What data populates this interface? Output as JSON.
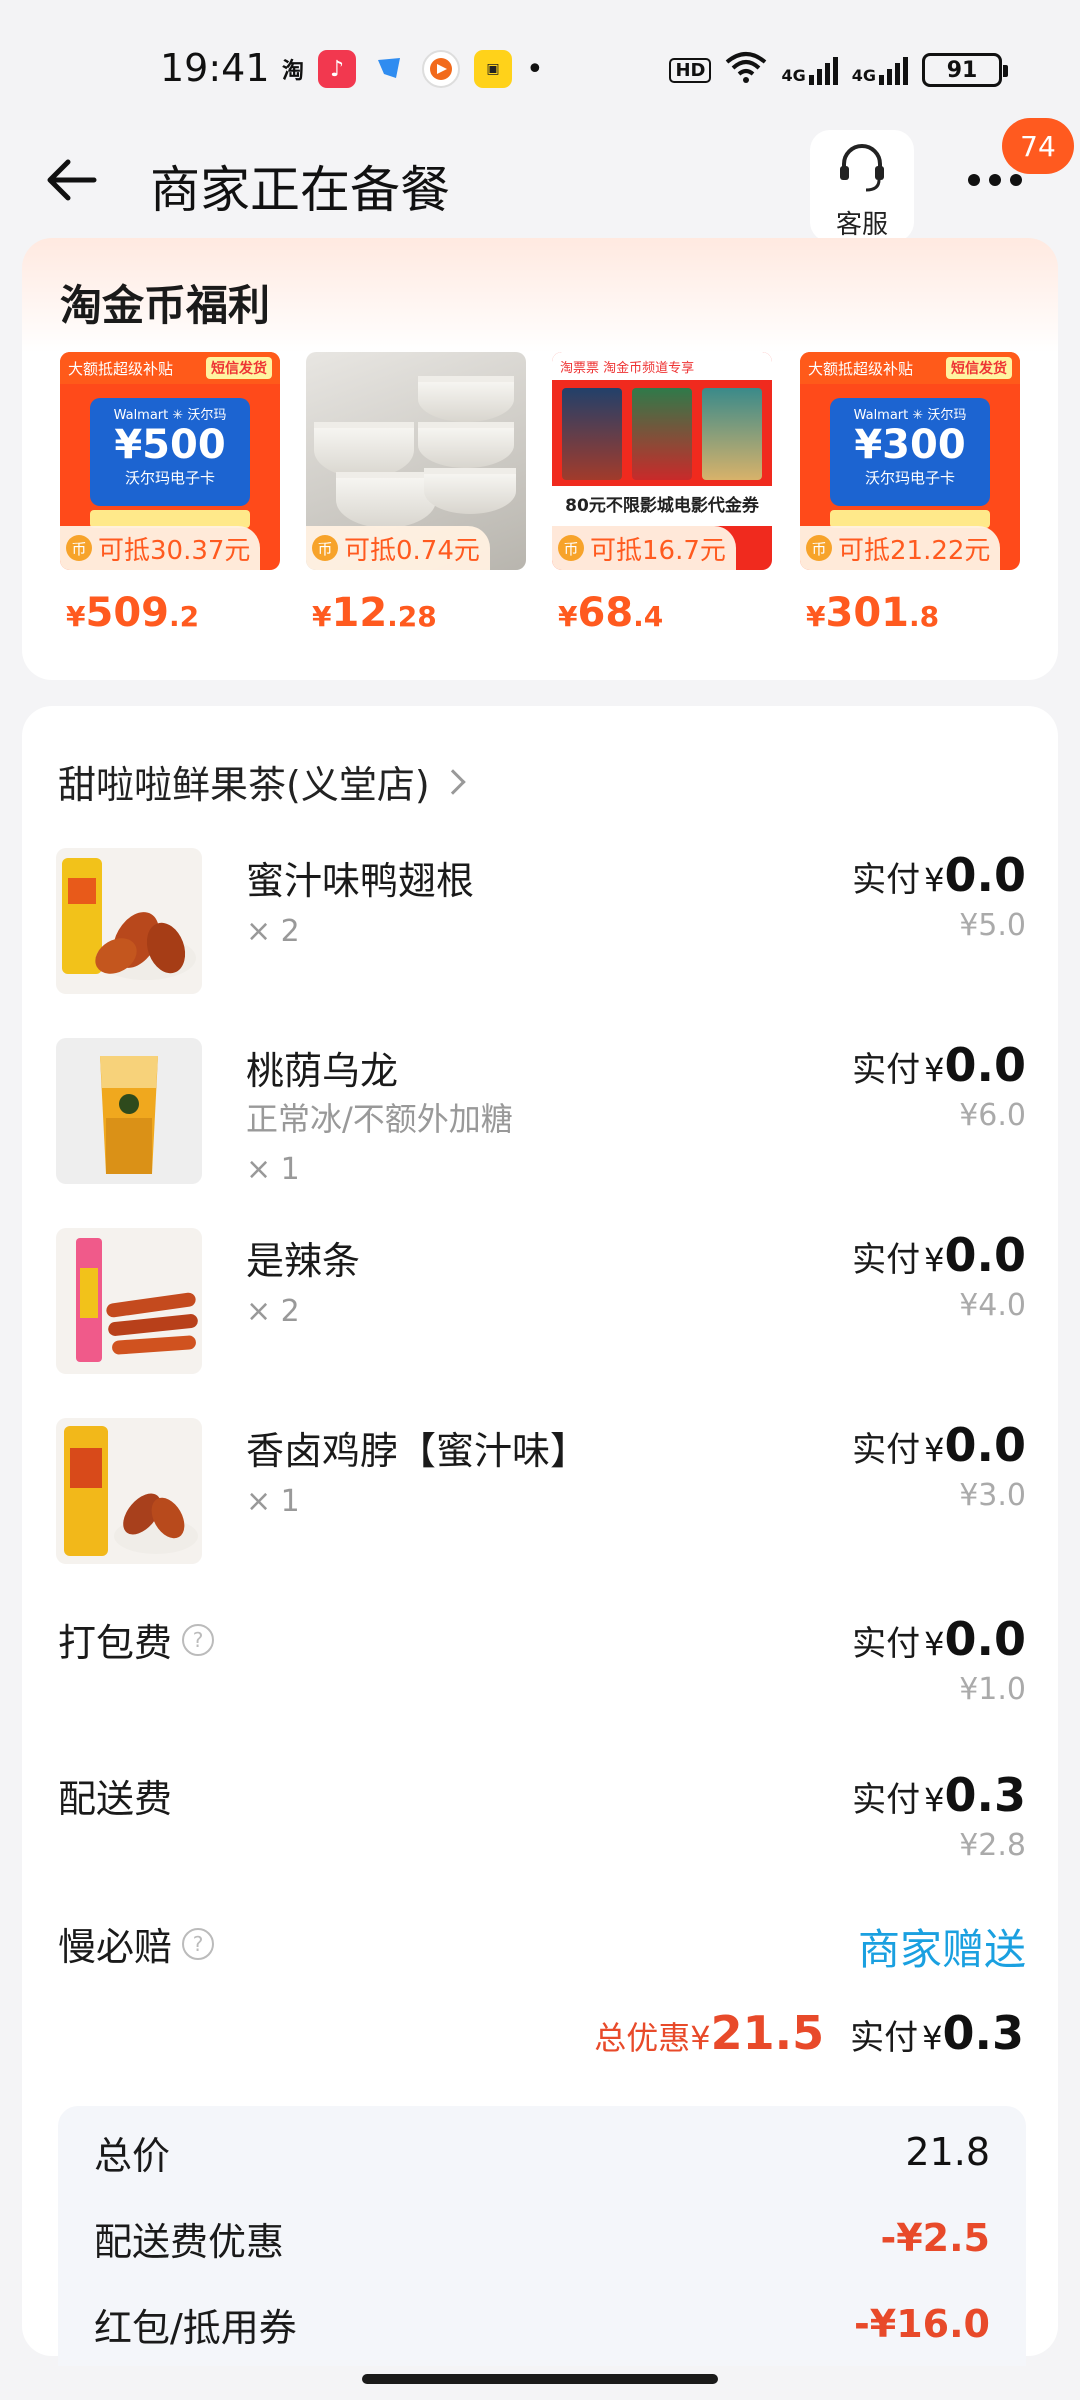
{
  "status_bar": {
    "time": "19:41",
    "app_icons": [
      "taobao-app-icon",
      "music-app-icon",
      "messenger-app-icon",
      "video-app-icon",
      "game-app-icon"
    ],
    "taobao_glyph": "淘",
    "dot": "•",
    "hd_label": "HD",
    "net1": "4G",
    "net2": "4G",
    "battery": "91"
  },
  "header": {
    "title": "商家正在备餐",
    "cs_label": "客服",
    "badge": "74"
  },
  "welfare": {
    "title": "淘金币福利",
    "products": [
      {
        "deduct": "可抵30.37元",
        "sym": "¥",
        "int": "509",
        "dec": ".2",
        "banner": "大额抵超级补贴",
        "tag": "短信发货",
        "card_brand": "Walmart ✳ 沃尔玛",
        "amount": "¥500",
        "card_name": "沃尔玛电子卡"
      },
      {
        "deduct": "可抵0.74元",
        "sym": "¥",
        "int": "12",
        "dec": ".28"
      },
      {
        "deduct": "可抵16.7元",
        "sym": "¥",
        "int": "68",
        "dec": ".4",
        "banner": "淘票票 淘金币频道专享",
        "promo": "80元不限影城电影代金券"
      },
      {
        "deduct": "可抵21.22元",
        "sym": "¥",
        "int": "301",
        "dec": ".8",
        "banner": "大额抵超级补贴",
        "tag": "短信发货",
        "card_brand": "Walmart ✳ 沃尔玛",
        "amount": "¥300",
        "card_name": "沃尔玛电子卡"
      }
    ]
  },
  "order": {
    "shop_name": "甜啦啦鲜果茶(义堂店)",
    "pay_label": "实付",
    "currency": "¥",
    "items": [
      {
        "name": "蜜汁味鸭翅根",
        "spec": "",
        "qty": "× 2",
        "paid": "0.0",
        "original": "¥5.0"
      },
      {
        "name": "桃荫乌龙",
        "spec": "正常冰/不额外加糖",
        "qty": "× 1",
        "paid": "0.0",
        "original": "¥6.0"
      },
      {
        "name": "是辣条",
        "spec": "",
        "qty": "× 2",
        "paid": "0.0",
        "original": "¥4.0"
      },
      {
        "name": "香卤鸡脖【蜜汁味】",
        "spec": "",
        "qty": "× 1",
        "paid": "0.0",
        "original": "¥3.0"
      }
    ],
    "fees": [
      {
        "name": "打包费",
        "paid": "0.0",
        "original": "¥1.0"
      },
      {
        "name": "配送费",
        "paid": "0.3",
        "original": "¥2.8"
      }
    ],
    "guarantee": {
      "name": "慢必赔",
      "value": "商家赠送"
    },
    "summary": {
      "discount_label": "总优惠",
      "discount_value": "21.5",
      "paid_label": "实付",
      "paid_value": "0.3"
    },
    "totals": [
      {
        "name": "总价",
        "value": "21.8"
      },
      {
        "name": "配送费优惠",
        "value": "-¥2.5"
      },
      {
        "name": "红包/抵用券",
        "value": "-¥16.0"
      }
    ]
  },
  "colors": {
    "accent": "#ff5a1f",
    "discount_red": "#e84a2a",
    "gift_blue": "#1aa0e0"
  }
}
